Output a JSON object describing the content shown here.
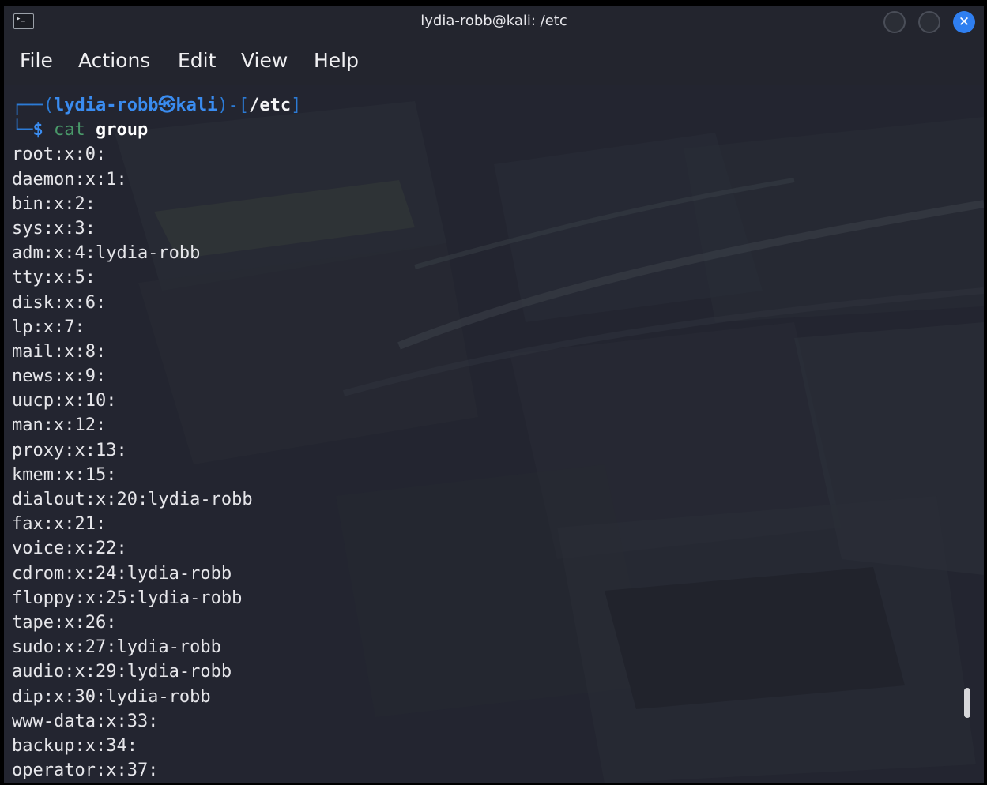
{
  "window": {
    "title": "lydia-robb@kali: /etc",
    "terminal_icon_glyph": "▸_",
    "close_glyph": "✕"
  },
  "menu": {
    "file": "File",
    "actions": "Actions",
    "edit": "Edit",
    "view": "View",
    "help": "Help"
  },
  "prompt": {
    "open_prefix": "┌──(",
    "user_host": "lydia-robb㉿kali",
    "mid": ")-[",
    "path": "/etc",
    "close": "]",
    "line2_prefix": "└─",
    "symbol": "$",
    "command": "cat",
    "argument": "group"
  },
  "output_lines": [
    "root:x:0:",
    "daemon:x:1:",
    "bin:x:2:",
    "sys:x:3:",
    "adm:x:4:lydia-robb",
    "tty:x:5:",
    "disk:x:6:",
    "lp:x:7:",
    "mail:x:8:",
    "news:x:9:",
    "uucp:x:10:",
    "man:x:12:",
    "proxy:x:13:",
    "kmem:x:15:",
    "dialout:x:20:lydia-robb",
    "fax:x:21:",
    "voice:x:22:",
    "cdrom:x:24:lydia-robb",
    "floppy:x:25:lydia-robb",
    "tape:x:26:",
    "sudo:x:27:lydia-robb",
    "audio:x:29:lydia-robb",
    "dip:x:30:lydia-robb",
    "www-data:x:33:",
    "backup:x:34:",
    "operator:x:37:"
  ],
  "colors": {
    "window_bg": "#23252e",
    "prompt_blue": "#2c7bd6",
    "close_button": "#2f7ff0",
    "output_text": "#e6e6ea"
  }
}
